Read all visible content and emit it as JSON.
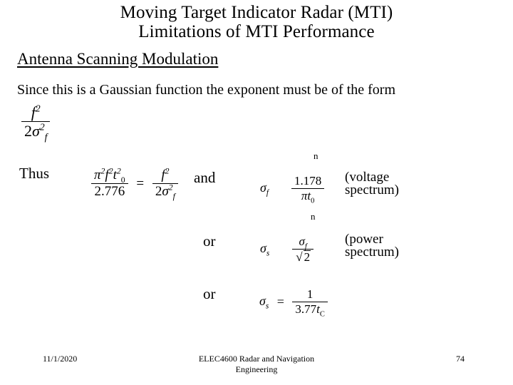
{
  "slide": {
    "background_color": "#ffffff",
    "text_color": "#000000",
    "title": {
      "line1": "Moving Target Indicator Radar (MTI)",
      "line2": "Limitations of MTI Performance"
    },
    "section_heading": "Antenna Scanning Modulation",
    "body_sentence": "Since this is a Gaussian function the exponent must be of the form",
    "formula_exponent": {
      "numerator": "f",
      "numerator_exponent": "2",
      "denominator_coefficient": "2",
      "denominator_symbol": "σ",
      "denominator_subscript": "f",
      "denominator_exponent": "2"
    },
    "row_thus": {
      "label": "Thus",
      "lhs": {
        "numerator_pi": "π",
        "numerator_pi_exp": "2",
        "numerator_f": "f",
        "numerator_f_exp": "2",
        "numerator_t": "t",
        "numerator_t_sub": "0",
        "numerator_t_exp": "2",
        "denominator": "2.776"
      },
      "equals": "=",
      "rhs": {
        "numerator": "f",
        "numerator_exponent": "2",
        "denominator_coefficient": "2",
        "denominator_symbol": "σ",
        "denominator_subscript": "f",
        "denominator_exponent": "2"
      },
      "connector": "and"
    },
    "row_voltage": {
      "artifact_glyph": "n",
      "symbol": "σ",
      "symbol_subscript": "f",
      "numerator": "1.178",
      "denominator_pi": "π",
      "denominator_t": "t",
      "denominator_t_sub": "0",
      "note_line1": "(voltage",
      "note_line2": "spectrum)"
    },
    "row_power": {
      "label": "or",
      "artifact_glyph": "n",
      "symbol": "σ",
      "symbol_subscript": "s",
      "numerator_symbol": "σ",
      "numerator_subscript": "f",
      "denominator_radical": "√",
      "denominator_radicand": "2",
      "note_line1": "(power",
      "note_line2": "spectrum)"
    },
    "row_tc": {
      "label": "or",
      "symbol": "σ",
      "symbol_subscript": "s",
      "equals": "=",
      "numerator": "1",
      "denominator_coefficient": "3.77",
      "denominator_t": "t",
      "denominator_t_sub": "C"
    },
    "footer": {
      "date": "11/1/2020",
      "center_line1": "ELEC4600 Radar and Navigation",
      "center_line2": "Engineering",
      "page_number": "74"
    }
  }
}
